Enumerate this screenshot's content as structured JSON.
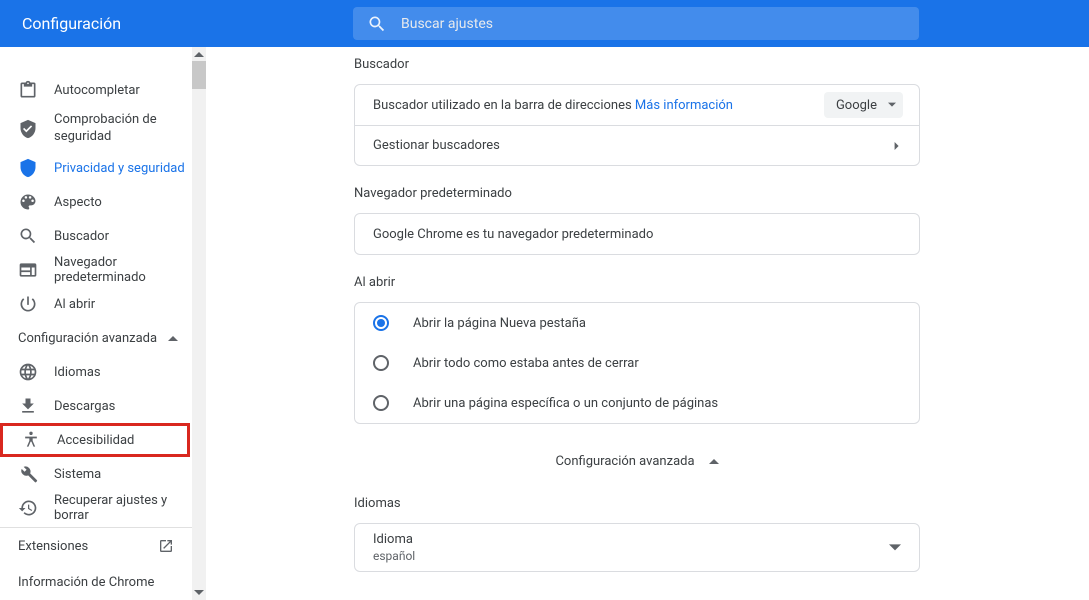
{
  "topbar": {
    "title": "Configuración",
    "search_placeholder": "Buscar ajustes"
  },
  "sidebar": {
    "items": [
      {
        "label": ""
      },
      {
        "label": "Autocompletar"
      },
      {
        "label": "Comprobación de seguridad"
      },
      {
        "label": "Privacidad y seguridad"
      },
      {
        "label": "Aspecto"
      },
      {
        "label": "Buscador"
      },
      {
        "label": "Navegador predeterminado"
      },
      {
        "label": "Al abrir"
      }
    ],
    "advanced": "Configuración avanzada",
    "adv_items": [
      {
        "label": "Idiomas"
      },
      {
        "label": "Descargas"
      },
      {
        "label": "Accesibilidad"
      },
      {
        "label": "Sistema"
      },
      {
        "label": "Recuperar ajustes y borrar"
      }
    ],
    "extensions": "Extensiones",
    "about": "Información de Chrome"
  },
  "content": {
    "buscador": {
      "title": "Buscador",
      "row1_text": "Buscador utilizado en la barra de direcciones ",
      "more_info": "Más información",
      "select_value": "Google",
      "row2": "Gestionar buscadores"
    },
    "navdef": {
      "title": "Navegador predeterminado",
      "text": "Google Chrome es tu navegador predeterminado"
    },
    "alabrir": {
      "title": "Al abrir",
      "opt1": "Abrir la página Nueva pestaña",
      "opt2": "Abrir todo como estaba antes de cerrar",
      "opt3": "Abrir una página específica o un conjunto de páginas"
    },
    "adv_toggle": "Configuración avanzada",
    "idiomas": {
      "title": "Idiomas",
      "row_label": "Idioma",
      "row_value": "español"
    }
  }
}
